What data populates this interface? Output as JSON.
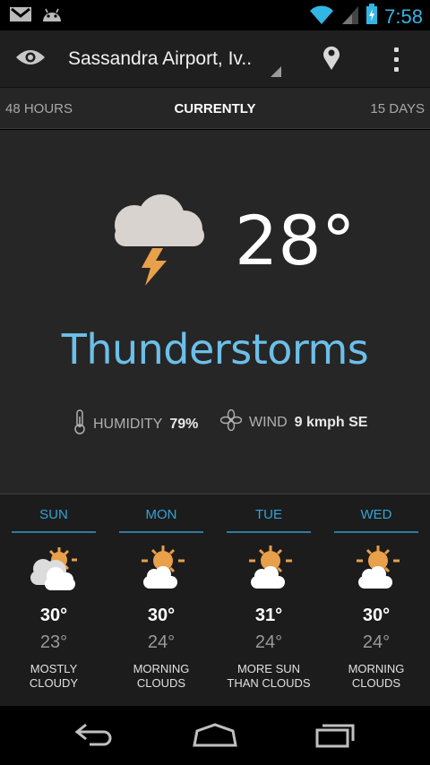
{
  "status_bar": {
    "time": "7:58",
    "icons": [
      "gmail-icon",
      "android-icon",
      "wifi-icon",
      "signal-icon",
      "battery-icon"
    ]
  },
  "action_bar": {
    "location": "Sassandra Airport, Iv..",
    "icons": [
      "eye-icon",
      "location-pin-icon",
      "overflow-menu-icon"
    ]
  },
  "tabs": {
    "left": "48 HOURS",
    "center": "CURRENTLY",
    "right": "15 DAYS"
  },
  "current": {
    "temperature": "28°",
    "condition": "Thunderstorms",
    "icon": "thunderstorm-icon",
    "humidity_label": "HUMIDITY",
    "humidity_value": "79%",
    "wind_label": "WIND",
    "wind_value": "9 kmph SE"
  },
  "forecast": [
    {
      "day": "SUN",
      "high": "30°",
      "low": "23°",
      "desc_line1": "MOSTLY",
      "desc_line2": "CLOUDY",
      "icon": "mostly-cloudy-icon"
    },
    {
      "day": "MON",
      "high": "30°",
      "low": "24°",
      "desc_line1": "MORNING",
      "desc_line2": "CLOUDS",
      "icon": "partly-sunny-icon"
    },
    {
      "day": "TUE",
      "high": "31°",
      "low": "24°",
      "desc_line1": "MORE SUN",
      "desc_line2": "THAN CLOUDS",
      "icon": "partly-sunny-icon"
    },
    {
      "day": "WED",
      "high": "30°",
      "low": "24°",
      "desc_line1": "MORNING",
      "desc_line2": "CLOUDS",
      "icon": "partly-sunny-icon"
    }
  ],
  "colors": {
    "accent": "#33b5e5",
    "condition_text": "#6cbfe8",
    "sun": "#e8a04a",
    "cloud": "#d8d3cf"
  },
  "nav_bar": {
    "icons": [
      "back-icon",
      "home-icon",
      "recent-apps-icon"
    ]
  }
}
